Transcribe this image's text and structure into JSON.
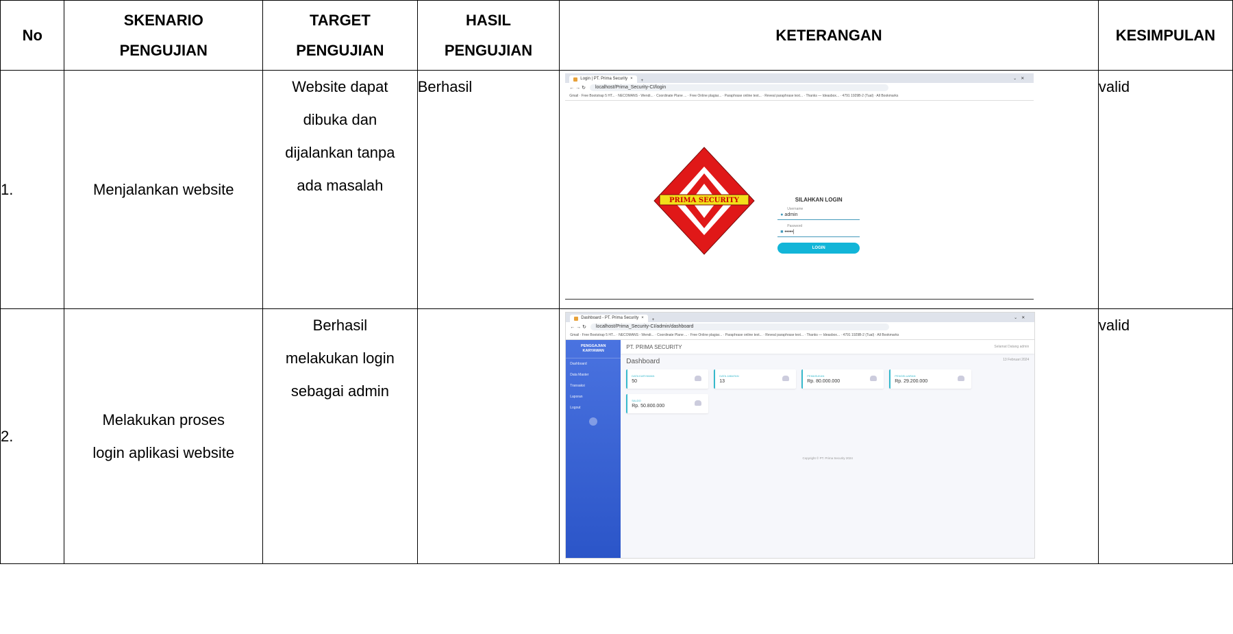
{
  "headers": {
    "no": "No",
    "skenario": [
      "SKENARIO",
      "PENGUJIAN"
    ],
    "target": [
      "TARGET",
      "PENGUJIAN"
    ],
    "hasil": [
      "HASIL",
      "PENGUJIAN"
    ],
    "keterangan": "KETERANGAN",
    "kesimpulan": "KESIMPULAN"
  },
  "rows": [
    {
      "no": "1.",
      "skenario": "Menjalankan website",
      "target": [
        "Website dapat",
        "dibuka dan",
        "dijalankan tanpa",
        "ada masalah"
      ],
      "hasil": "Berhasil",
      "kesimpulan": "valid",
      "shot": {
        "tab": "Login | PT. Prima Security",
        "url": "localhost/Prima_Security-CI/login",
        "bookmarks": "Gmail · Free Bootstrap 5 HT... · NECOMANS - Wendi... · Coordinate Plane ... · Free Online plagiar... · Paraphrase online text... · Reveal paraphrase text... · Thanks — Ideasbox... · 4791 1929B-2 (Tual) · All Bookmarks",
        "logo_text": "PRIMA SECURITY",
        "form_title": "SILAHKAN LOGIN",
        "username_label": "Username",
        "username_value": "admin",
        "password_label": "Password",
        "password_value": "•••••|",
        "button": "LOGIN"
      }
    },
    {
      "no": "2.",
      "skenario": [
        "Melakukan proses",
        "login aplikasi website"
      ],
      "target": [
        "Berhasil",
        "melakukan login",
        "sebagai admin"
      ],
      "hasil": "",
      "kesimpulan": "valid",
      "shot": {
        "tab": "Dashboard - PT. Prima Security",
        "url": "localhost/Prima_Security-CI/admin/dashboard",
        "bookmarks": "Gmail · Free Bootstrap 5 HT... · NECOMANS - Wendi... · Coordinate Plane ... · Free Online plagiar... · Paraphrase online text... · Reveal paraphrase text... · Thanks — Ideasbox... · 4791 1929B-2 (Tual) · All Bookmarks",
        "brand": [
          "PENGGAJIAN",
          "KARYAWAN"
        ],
        "menu": [
          "Dashboard",
          "Data Master",
          "Transaksi",
          "Laporan",
          "Logout"
        ],
        "top_title": "PT. PRIMA SECURITY",
        "top_user": "Selamat Datang admin",
        "heading": "Dashboard",
        "date": "13 Februari 2024",
        "cards": [
          {
            "label": "DATA KARYAWAN",
            "value": "50"
          },
          {
            "label": "DATA JABATAN",
            "value": "13"
          },
          {
            "label": "PEMASUKAN",
            "value": "Rp. 80.000.000"
          },
          {
            "label": "PENGELUARAN",
            "value": "Rp. 29.200.000"
          },
          {
            "label": "SALDO",
            "value": "Rp. 50.800.000"
          }
        ],
        "footer": "Copyright © PT. Prima Security 2024"
      }
    }
  ]
}
